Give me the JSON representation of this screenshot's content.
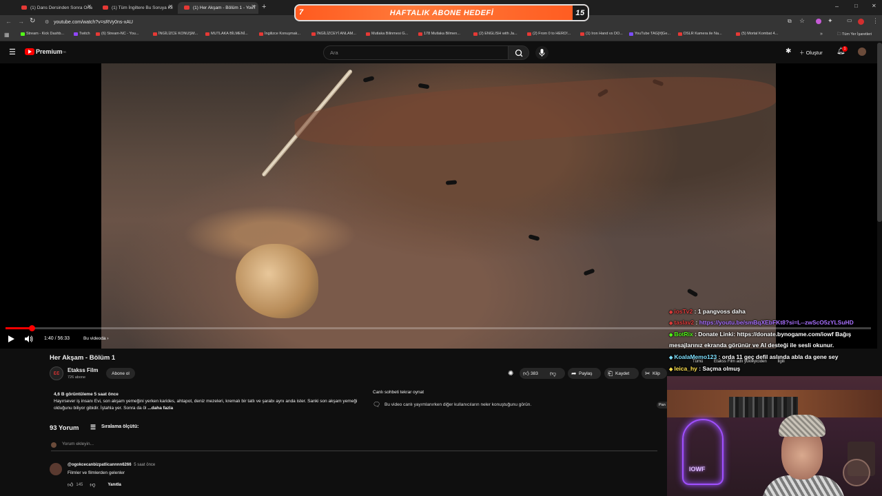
{
  "browser": {
    "tabs": [
      {
        "title": "(1) Dans Dersinden Sonra Orta"
      },
      {
        "title": "(1) Tüm İngiltere Bu Soruya Kil"
      },
      {
        "title": "(1) Her Akşam - Bölüm 1 - YouT"
      }
    ],
    "url": "youtube.com/watch?v=sRVy0ns-xAU",
    "bookmarks": [
      "Stream - Kick Dashb...",
      "Twitch",
      "(6) Stream-NC - You...",
      "İNGİLİZCE KONUŞM...",
      "MUTLAKA BİLMENİ...",
      "İngilizce Konuşmak...",
      "İNGİLİZCEYİ ANLAM...",
      "Mutlaka Bilinmesi G...",
      "178 Mutlaka Bilmen...",
      "(2) ENGLISH with Ja...",
      "(2) From 0 to HERO!...",
      "(1) Iron Hand vs DO...",
      "YouTube TAG[#]Ge...",
      "DSLR Kamera ile Na...",
      "(5) Mortal Kombat 4..."
    ],
    "bookmarks_other": "Tüm Yer İşaretleri"
  },
  "overlay_goal": {
    "label": "HAFTALIK ABONE HEDEFİ",
    "current": "7",
    "target": "15",
    "progress": 0.47
  },
  "youtube": {
    "logo": "Premium",
    "logo_region": "TR",
    "search_placeholder": "Ara",
    "create_label": "Oluştur",
    "notification_count": "1"
  },
  "player": {
    "time": "1:40 / 56:33",
    "chapter": "Bu videoda",
    "progress": 0.03
  },
  "video": {
    "title": "Her Akşam - Bölüm 1",
    "channel_name": "Etakss Film",
    "channel_initials": "ƐƐ",
    "subscribers": "726 abone",
    "subscribe_label": "Abone ol",
    "likes": "383",
    "share_label": "Paylaş",
    "save_label": "Kaydet",
    "clip_label": "Klip",
    "views_time": "4,6 B görüntüleme  5 saat önce",
    "description": "Hayırsever iş insanı Evi, son akşam yemeğini yerken karides, ahtapot, deniz mezeleri, kremalı bir tatlı ve şarabı aynı anda ister. Sanki son akşam yemeği olduğunu biliyor gibidir. İştahla yer. Sonra da öl",
    "more_label": "...daha fazla",
    "side_trunc": "Pan"
  },
  "live_chat_replay": {
    "title": "Canlı sohbeti tekrar oynat",
    "desc": "Bu video canlı yayımlanırken diğer kullanıcıların neler konuştuğunu görün."
  },
  "comments": {
    "count": "93 Yorum",
    "sort_label": "Sıralama ölçütü:",
    "add_placeholder": "Yorum ekleyin...",
    "items": [
      {
        "author": "@ogokcecanbizpatlicannnn6266",
        "time": "5 saat önce",
        "text": "Filmler ve filmlerden gelenler",
        "likes": "145",
        "reply_label": "Yanıtla"
      }
    ]
  },
  "stream_chat": {
    "lines": [
      {
        "user": "iosTv2",
        "user_color": "#e03b3b",
        "text": "1 pangvoss daha",
        "text_color": "#ffffff"
      },
      {
        "user": "taslav2",
        "user_color": "#e03b3b",
        "text": "https://youtu.be/smBqXEbFKt8?si=L--zwScO5zYLSuHD",
        "text_color": "#a970ff"
      },
      {
        "user": "BotRix",
        "user_color": "#53fc18",
        "text": "Donate Linki: https://donate.bynogame.com/iowf Bağış",
        "text_color": "#ffffff"
      },
      {
        "user": "",
        "user_color": "#ffffff",
        "text": "mesajlarınız ekranda görünür ve AI desteği ile sesli okunur.",
        "text_color": "#ffffff"
      },
      {
        "user": "KoalaMemo123",
        "user_color": "#7ee0ff",
        "text": "orda 11 geç defil aslında abla da gene sey",
        "text_color": "#ffffff"
      },
      {
        "user": "leica_hy",
        "user_color": "#ffe14d",
        "text": "Saçma olmuş",
        "text_color": "#ffffff"
      }
    ],
    "chip_tabs": [
      "Tümü",
      "Etakss Film adlı yükleyiciden",
      "İlgili"
    ]
  },
  "webcam": {
    "neon_label": "IOWF"
  },
  "colors": {
    "accent": "#ff0000",
    "bg": "#0f0f0f",
    "goal_orange": "#ff5a1f"
  }
}
